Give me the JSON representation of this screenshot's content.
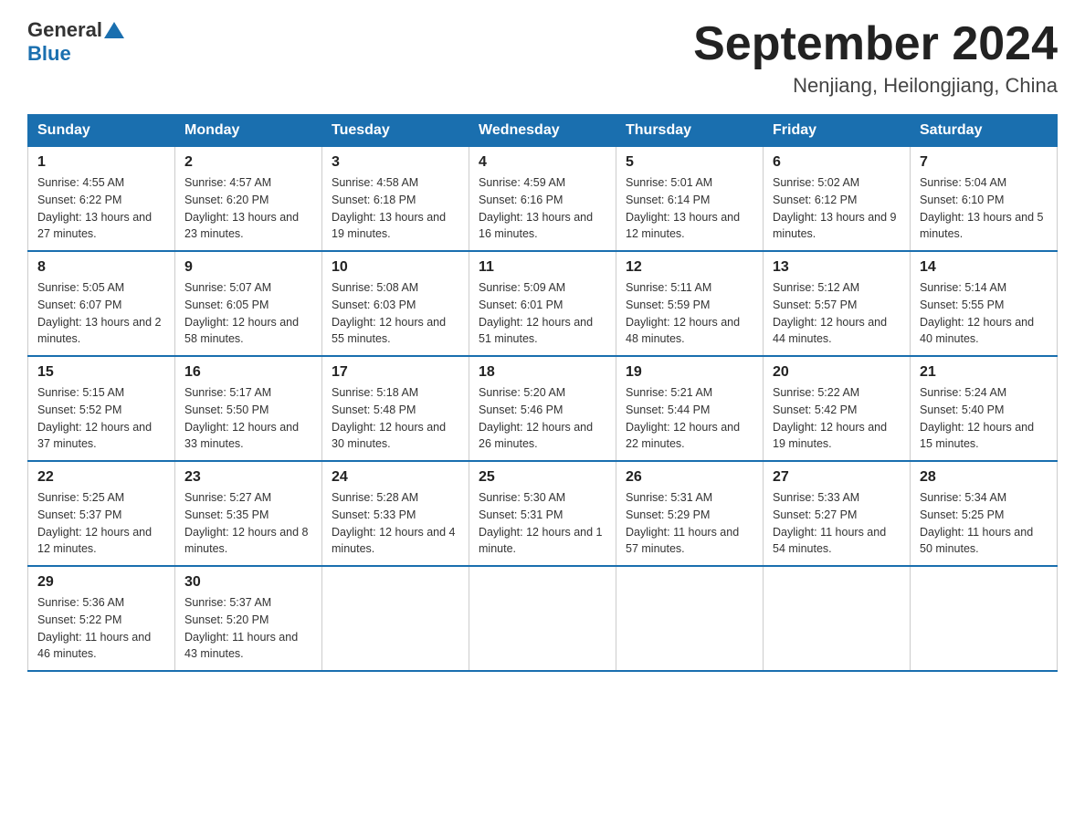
{
  "header": {
    "logo_general": "General",
    "logo_blue": "Blue",
    "title": "September 2024",
    "subtitle": "Nenjiang, Heilongjiang, China"
  },
  "columns": [
    "Sunday",
    "Monday",
    "Tuesday",
    "Wednesday",
    "Thursday",
    "Friday",
    "Saturday"
  ],
  "weeks": [
    [
      {
        "day": "1",
        "sunrise": "Sunrise: 4:55 AM",
        "sunset": "Sunset: 6:22 PM",
        "daylight": "Daylight: 13 hours and 27 minutes."
      },
      {
        "day": "2",
        "sunrise": "Sunrise: 4:57 AM",
        "sunset": "Sunset: 6:20 PM",
        "daylight": "Daylight: 13 hours and 23 minutes."
      },
      {
        "day": "3",
        "sunrise": "Sunrise: 4:58 AM",
        "sunset": "Sunset: 6:18 PM",
        "daylight": "Daylight: 13 hours and 19 minutes."
      },
      {
        "day": "4",
        "sunrise": "Sunrise: 4:59 AM",
        "sunset": "Sunset: 6:16 PM",
        "daylight": "Daylight: 13 hours and 16 minutes."
      },
      {
        "day": "5",
        "sunrise": "Sunrise: 5:01 AM",
        "sunset": "Sunset: 6:14 PM",
        "daylight": "Daylight: 13 hours and 12 minutes."
      },
      {
        "day": "6",
        "sunrise": "Sunrise: 5:02 AM",
        "sunset": "Sunset: 6:12 PM",
        "daylight": "Daylight: 13 hours and 9 minutes."
      },
      {
        "day": "7",
        "sunrise": "Sunrise: 5:04 AM",
        "sunset": "Sunset: 6:10 PM",
        "daylight": "Daylight: 13 hours and 5 minutes."
      }
    ],
    [
      {
        "day": "8",
        "sunrise": "Sunrise: 5:05 AM",
        "sunset": "Sunset: 6:07 PM",
        "daylight": "Daylight: 13 hours and 2 minutes."
      },
      {
        "day": "9",
        "sunrise": "Sunrise: 5:07 AM",
        "sunset": "Sunset: 6:05 PM",
        "daylight": "Daylight: 12 hours and 58 minutes."
      },
      {
        "day": "10",
        "sunrise": "Sunrise: 5:08 AM",
        "sunset": "Sunset: 6:03 PM",
        "daylight": "Daylight: 12 hours and 55 minutes."
      },
      {
        "day": "11",
        "sunrise": "Sunrise: 5:09 AM",
        "sunset": "Sunset: 6:01 PM",
        "daylight": "Daylight: 12 hours and 51 minutes."
      },
      {
        "day": "12",
        "sunrise": "Sunrise: 5:11 AM",
        "sunset": "Sunset: 5:59 PM",
        "daylight": "Daylight: 12 hours and 48 minutes."
      },
      {
        "day": "13",
        "sunrise": "Sunrise: 5:12 AM",
        "sunset": "Sunset: 5:57 PM",
        "daylight": "Daylight: 12 hours and 44 minutes."
      },
      {
        "day": "14",
        "sunrise": "Sunrise: 5:14 AM",
        "sunset": "Sunset: 5:55 PM",
        "daylight": "Daylight: 12 hours and 40 minutes."
      }
    ],
    [
      {
        "day": "15",
        "sunrise": "Sunrise: 5:15 AM",
        "sunset": "Sunset: 5:52 PM",
        "daylight": "Daylight: 12 hours and 37 minutes."
      },
      {
        "day": "16",
        "sunrise": "Sunrise: 5:17 AM",
        "sunset": "Sunset: 5:50 PM",
        "daylight": "Daylight: 12 hours and 33 minutes."
      },
      {
        "day": "17",
        "sunrise": "Sunrise: 5:18 AM",
        "sunset": "Sunset: 5:48 PM",
        "daylight": "Daylight: 12 hours and 30 minutes."
      },
      {
        "day": "18",
        "sunrise": "Sunrise: 5:20 AM",
        "sunset": "Sunset: 5:46 PM",
        "daylight": "Daylight: 12 hours and 26 minutes."
      },
      {
        "day": "19",
        "sunrise": "Sunrise: 5:21 AM",
        "sunset": "Sunset: 5:44 PM",
        "daylight": "Daylight: 12 hours and 22 minutes."
      },
      {
        "day": "20",
        "sunrise": "Sunrise: 5:22 AM",
        "sunset": "Sunset: 5:42 PM",
        "daylight": "Daylight: 12 hours and 19 minutes."
      },
      {
        "day": "21",
        "sunrise": "Sunrise: 5:24 AM",
        "sunset": "Sunset: 5:40 PM",
        "daylight": "Daylight: 12 hours and 15 minutes."
      }
    ],
    [
      {
        "day": "22",
        "sunrise": "Sunrise: 5:25 AM",
        "sunset": "Sunset: 5:37 PM",
        "daylight": "Daylight: 12 hours and 12 minutes."
      },
      {
        "day": "23",
        "sunrise": "Sunrise: 5:27 AM",
        "sunset": "Sunset: 5:35 PM",
        "daylight": "Daylight: 12 hours and 8 minutes."
      },
      {
        "day": "24",
        "sunrise": "Sunrise: 5:28 AM",
        "sunset": "Sunset: 5:33 PM",
        "daylight": "Daylight: 12 hours and 4 minutes."
      },
      {
        "day": "25",
        "sunrise": "Sunrise: 5:30 AM",
        "sunset": "Sunset: 5:31 PM",
        "daylight": "Daylight: 12 hours and 1 minute."
      },
      {
        "day": "26",
        "sunrise": "Sunrise: 5:31 AM",
        "sunset": "Sunset: 5:29 PM",
        "daylight": "Daylight: 11 hours and 57 minutes."
      },
      {
        "day": "27",
        "sunrise": "Sunrise: 5:33 AM",
        "sunset": "Sunset: 5:27 PM",
        "daylight": "Daylight: 11 hours and 54 minutes."
      },
      {
        "day": "28",
        "sunrise": "Sunrise: 5:34 AM",
        "sunset": "Sunset: 5:25 PM",
        "daylight": "Daylight: 11 hours and 50 minutes."
      }
    ],
    [
      {
        "day": "29",
        "sunrise": "Sunrise: 5:36 AM",
        "sunset": "Sunset: 5:22 PM",
        "daylight": "Daylight: 11 hours and 46 minutes."
      },
      {
        "day": "30",
        "sunrise": "Sunrise: 5:37 AM",
        "sunset": "Sunset: 5:20 PM",
        "daylight": "Daylight: 11 hours and 43 minutes."
      },
      null,
      null,
      null,
      null,
      null
    ]
  ]
}
